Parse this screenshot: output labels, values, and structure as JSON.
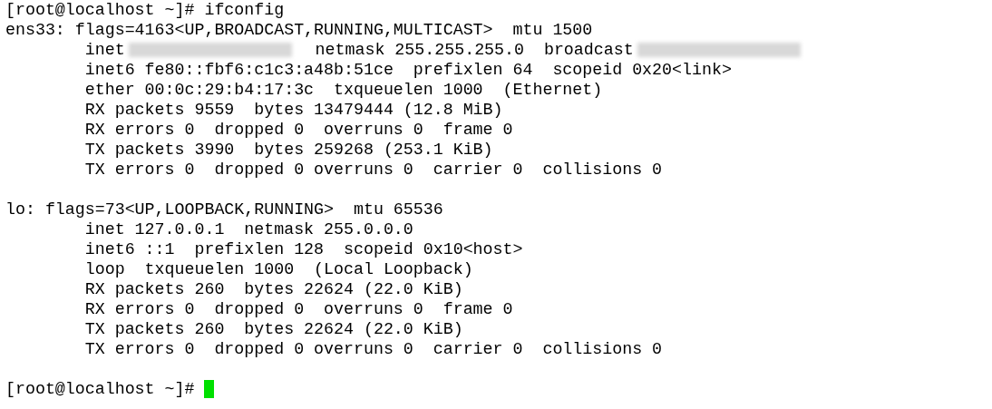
{
  "terminal": {
    "lines": [
      {
        "segments": [
          {
            "kind": "text",
            "text": "[root@localhost ~]# ifconfig"
          }
        ]
      },
      {
        "segments": [
          {
            "kind": "text",
            "text": "ens33: flags=4163<UP,BROADCAST,RUNNING,MULTICAST>  mtu 1500"
          }
        ]
      },
      {
        "segments": [
          {
            "kind": "text",
            "text": "        inet"
          },
          {
            "kind": "redacted"
          },
          {
            "kind": "text",
            "text": "  netmask 255.255.255.0  broadcast"
          },
          {
            "kind": "redacted"
          }
        ]
      },
      {
        "segments": [
          {
            "kind": "text",
            "text": "        inet6 fe80::fbf6:c1c3:a48b:51ce  prefixlen 64  scopeid 0x20<link>"
          }
        ]
      },
      {
        "segments": [
          {
            "kind": "text",
            "text": "        ether 00:0c:29:b4:17:3c  txqueuelen 1000  (Ethernet)"
          }
        ]
      },
      {
        "segments": [
          {
            "kind": "text",
            "text": "        RX packets 9559  bytes 13479444 (12.8 MiB)"
          }
        ]
      },
      {
        "segments": [
          {
            "kind": "text",
            "text": "        RX errors 0  dropped 0  overruns 0  frame 0"
          }
        ]
      },
      {
        "segments": [
          {
            "kind": "text",
            "text": "        TX packets 3990  bytes 259268 (253.1 KiB)"
          }
        ]
      },
      {
        "segments": [
          {
            "kind": "text",
            "text": "        TX errors 0  dropped 0 overruns 0  carrier 0  collisions 0"
          }
        ]
      },
      {
        "blank": true
      },
      {
        "segments": [
          {
            "kind": "text",
            "text": "lo: flags=73<UP,LOOPBACK,RUNNING>  mtu 65536"
          }
        ]
      },
      {
        "segments": [
          {
            "kind": "text",
            "text": "        inet 127.0.0.1  netmask 255.0.0.0"
          }
        ]
      },
      {
        "segments": [
          {
            "kind": "text",
            "text": "        inet6 ::1  prefixlen 128  scopeid 0x10<host>"
          }
        ]
      },
      {
        "segments": [
          {
            "kind": "text",
            "text": "        loop  txqueuelen 1000  (Local Loopback)"
          }
        ]
      },
      {
        "segments": [
          {
            "kind": "text",
            "text": "        RX packets 260  bytes 22624 (22.0 KiB)"
          }
        ]
      },
      {
        "segments": [
          {
            "kind": "text",
            "text": "        RX errors 0  dropped 0  overruns 0  frame 0"
          }
        ]
      },
      {
        "segments": [
          {
            "kind": "text",
            "text": "        TX packets 260  bytes 22624 (22.0 KiB)"
          }
        ]
      },
      {
        "segments": [
          {
            "kind": "text",
            "text": "        TX errors 0  dropped 0 overruns 0  carrier 0  collisions 0"
          }
        ]
      },
      {
        "blank": true
      },
      {
        "segments": [
          {
            "kind": "text",
            "text": "[root@localhost ~]# "
          }
        ],
        "cursor": true
      }
    ]
  }
}
